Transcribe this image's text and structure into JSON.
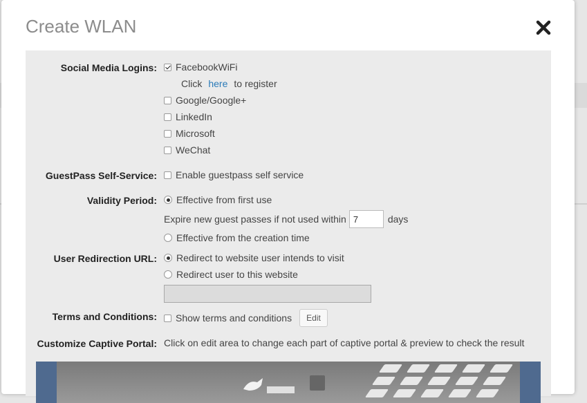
{
  "dialog": {
    "title": "Create WLAN",
    "close_icon": "close-icon"
  },
  "social_media": {
    "label": "Social Media Logins:",
    "options": [
      {
        "label": "FacebookWiFi",
        "checked": true
      },
      {
        "label": "Google/Google+",
        "checked": false
      },
      {
        "label": "LinkedIn",
        "checked": false
      },
      {
        "label": "Microsoft",
        "checked": false
      },
      {
        "label": "WeChat",
        "checked": false
      }
    ],
    "register_prefix": "Click",
    "register_link": "here",
    "register_suffix": "to register"
  },
  "guestpass": {
    "label": "GuestPass Self-Service:",
    "option": "Enable guestpass self service",
    "checked": false
  },
  "validity": {
    "label": "Validity Period:",
    "option_first_use": "Effective from first use",
    "expire_prefix": "Expire new guest passes if not used within",
    "expire_days": "7",
    "expire_suffix": "days",
    "option_creation": "Effective from the creation time",
    "selected": "first_use"
  },
  "redirection": {
    "label": "User Redirection URL:",
    "option_intended": "Redirect to website user intends to visit",
    "option_custom": "Redirect user to this website",
    "url_value": "",
    "selected": "intended"
  },
  "terms": {
    "label": "Terms and Conditions:",
    "option": "Show terms and conditions",
    "checked": false,
    "edit_button": "Edit"
  },
  "captive_portal": {
    "label": "Customize Captive Portal:",
    "hint": "Click on edit area to change each part of captive portal & preview to check the result"
  },
  "colors": {
    "dialog_bg": "#ffffff",
    "panel_bg": "#ebebeb",
    "link": "#2a7ab8",
    "title": "#8c8c8c",
    "portal_frame": "#4f6a8f"
  }
}
